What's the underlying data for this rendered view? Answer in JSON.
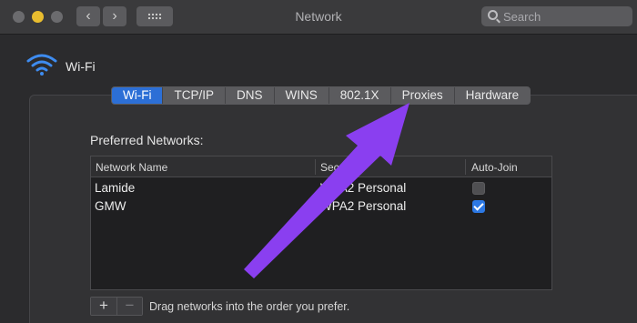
{
  "window": {
    "title": "Network"
  },
  "toolbar": {
    "back_icon": "chevron-left-icon",
    "forward_icon": "chevron-right-icon",
    "grid_icon": "grid-icon",
    "search_placeholder": "Search"
  },
  "service": {
    "name": "Wi-Fi",
    "icon": "wifi-icon"
  },
  "tabs": [
    {
      "label": "Wi-Fi",
      "active": true
    },
    {
      "label": "TCP/IP"
    },
    {
      "label": "DNS"
    },
    {
      "label": "WINS"
    },
    {
      "label": "802.1X"
    },
    {
      "label": "Proxies"
    },
    {
      "label": "Hardware"
    }
  ],
  "preferred_networks": {
    "label": "Preferred Networks:",
    "columns": [
      "Network Name",
      "Security",
      "Auto-Join"
    ],
    "rows": [
      {
        "name": "Lamide",
        "security": "WPA2 Personal",
        "auto_join": false
      },
      {
        "name": "GMW",
        "security": "WPA2 Personal",
        "auto_join": true
      }
    ]
  },
  "footer": {
    "add_label": "+",
    "remove_label": "−",
    "hint": "Drag networks into the order you prefer."
  },
  "colors": {
    "accent": "#2c6fd6",
    "annotation_arrow": "#8a3ff0",
    "minimize_light": "#e9bd2f"
  }
}
